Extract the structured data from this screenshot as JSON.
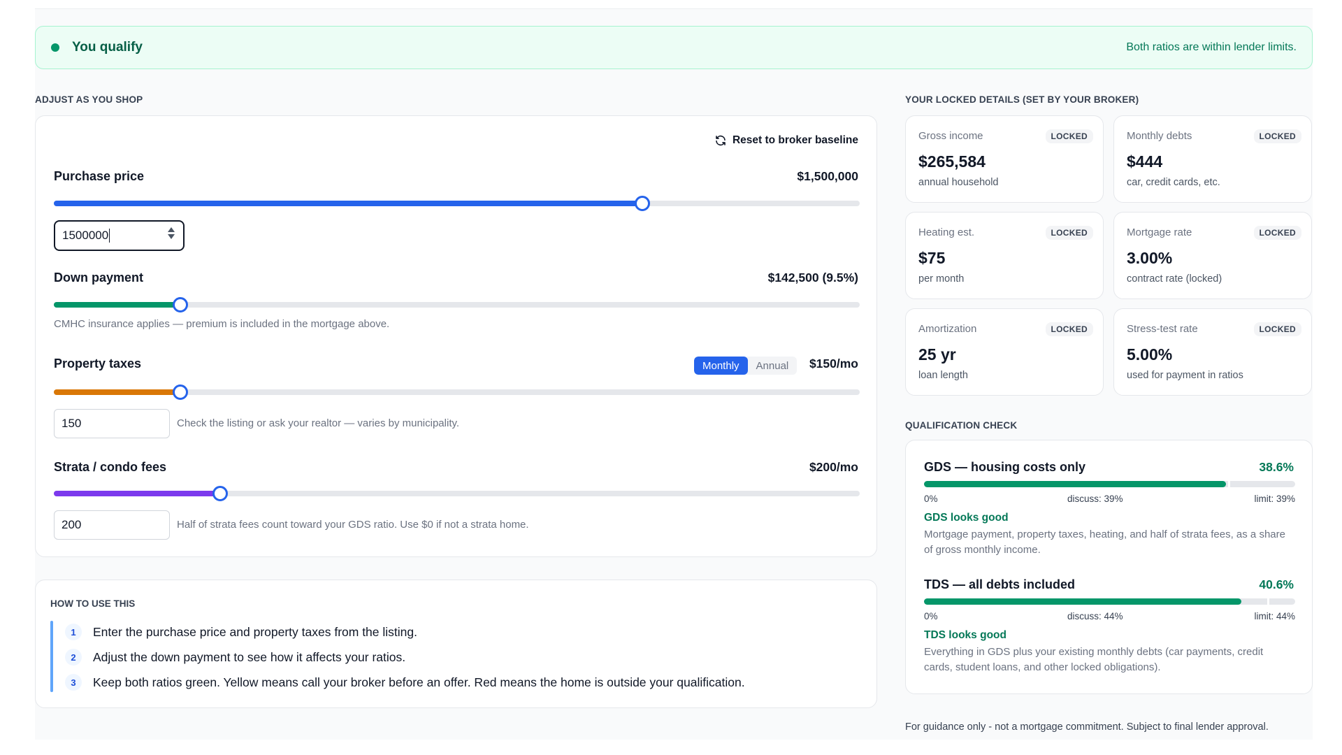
{
  "banner": {
    "title": "You qualify",
    "note": "Both ratios are within lender limits."
  },
  "adjust": {
    "section_label": "ADJUST AS YOU SHOP",
    "reset_label": "Reset to broker baseline",
    "purchase": {
      "label": "Purchase price",
      "display": "$1,500,000",
      "input": "1500000",
      "fraction": 0.73
    },
    "down": {
      "label": "Down payment",
      "display": "$142,500 (9.5%)",
      "fraction": 0.157,
      "hint": "CMHC insurance applies — premium is included in the mortgage above."
    },
    "taxes": {
      "label": "Property taxes",
      "toggle_monthly": "Monthly",
      "toggle_annual": "Annual",
      "display": "$150/mo",
      "input": "150",
      "fraction": 0.157,
      "hint": "Check the listing or ask your realtor — varies by municipality."
    },
    "strata": {
      "label": "Strata / condo fees",
      "display": "$200/mo",
      "input": "200",
      "fraction": 0.206,
      "hint": "Half of strata fees count toward your GDS ratio. Use $0 if not a strata home."
    }
  },
  "howto": {
    "title": "HOW TO USE THIS",
    "steps": [
      {
        "num": "1",
        "text": "Enter the purchase price and property taxes from the listing."
      },
      {
        "num": "2",
        "text": "Adjust the down payment to see how it affects your ratios."
      },
      {
        "num": "3",
        "text": "Keep both ratios green. Yellow means call your broker before an offer. Red means the home is outside your qualification."
      }
    ]
  },
  "locked": {
    "section_label": "YOUR LOCKED DETAILS (SET BY YOUR BROKER)",
    "badge": "LOCKED",
    "items": [
      {
        "label": "Gross income",
        "value": "$265,584",
        "sub": "annual household"
      },
      {
        "label": "Monthly debts",
        "value": "$444",
        "sub": "car, credit cards, etc."
      },
      {
        "label": "Heating est.",
        "value": "$75",
        "sub": "per month"
      },
      {
        "label": "Mortgage rate",
        "value": "3.00%",
        "sub": "contract rate (locked)"
      },
      {
        "label": "Amortization",
        "value": "25 yr",
        "sub": "loan length"
      },
      {
        "label": "Stress-test rate",
        "value": "5.00%",
        "sub": "used for payment in ratios"
      }
    ]
  },
  "qualification": {
    "section_label": "QUALIFICATION CHECK",
    "gds": {
      "title": "GDS — housing costs only",
      "pct": "38.6%",
      "fill": 0.386,
      "marker": 0.39,
      "scale_min": "0%",
      "scale_mid": "discuss: 39%",
      "scale_max": "limit: 39%",
      "status": "GDS looks good",
      "desc": "Mortgage payment, property taxes, heating, and half of strata fees, as a share of gross monthly income."
    },
    "tds": {
      "title": "TDS — all debts included",
      "pct": "40.6%",
      "fill": 0.406,
      "marker": 0.44,
      "scale_min": "0%",
      "scale_mid": "discuss: 44%",
      "scale_max": "limit: 44%",
      "status": "TDS looks good",
      "desc": "Everything in GDS plus your existing monthly debts (car payments, credit cards, student loans, and other locked obligations)."
    }
  },
  "footnote": "For guidance only - not a mortgage commitment. Subject to final lender approval.",
  "colors": {
    "purchase": "#2563eb",
    "down": "#059669",
    "taxes": "#d97706",
    "strata": "#7c3aed",
    "ok": "#059669"
  }
}
